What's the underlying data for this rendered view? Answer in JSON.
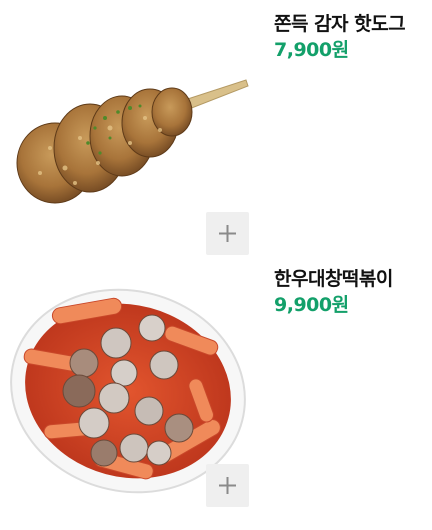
{
  "menu": {
    "items": [
      {
        "name": "쫀득 감자 핫도그",
        "price": "7,900원",
        "image_icon": "potato-hotdog-image"
      },
      {
        "name": "한우대창떡볶이",
        "price": "9,900원",
        "image_icon": "tteokbokki-image"
      }
    ],
    "add_button_icon": "plus-icon"
  },
  "colors": {
    "price": "#13a06a",
    "name": "#111111",
    "add_button_bg": "#efefef",
    "add_icon": "#8a8a8a"
  }
}
